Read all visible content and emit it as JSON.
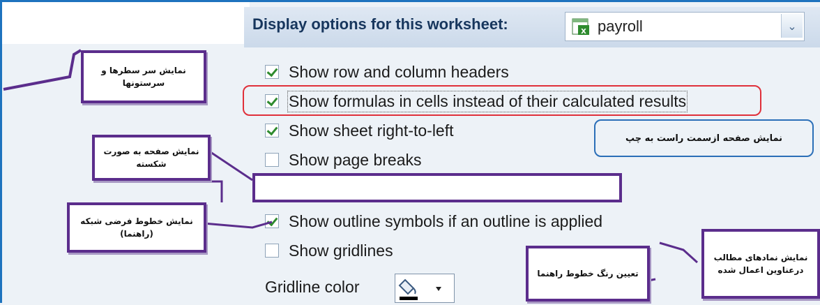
{
  "header": {
    "label": "Display options for this worksheet:",
    "sheet_name": "payroll"
  },
  "options": [
    {
      "label": "Show row and column headers",
      "checked": true
    },
    {
      "label": "Show formulas in cells instead of their calculated results",
      "checked": true
    },
    {
      "label": "Show sheet right-to-left",
      "checked": true
    },
    {
      "label": "Show page breaks",
      "checked": false
    },
    {
      "label": "Show outline symbols if an outline is applied",
      "checked": true
    },
    {
      "label": "Show gridlines",
      "checked": false
    }
  ],
  "gridline": {
    "label": "Gridline color"
  },
  "annotations": {
    "row_col_headers": "نمایش سر سطرها و سرستونها",
    "page_breaks": "نمایش صفحه به صورت شکسته",
    "gridlines": "نمایش خطوط فرضی شبکه (راهنما)",
    "right_to_left": "نمایش صفحه ازسمت راست به چپ",
    "outline_symbols": "نمایش نمادهای مطالب درعناوین اعمال شده",
    "gridline_color": "تعیین رنگ خطوط راهنما"
  },
  "colors": {
    "red_highlight": "#e0303a",
    "purple": "#5b2d8c",
    "blue": "#2b6fb8",
    "checkmark": "#2e8b2e"
  }
}
